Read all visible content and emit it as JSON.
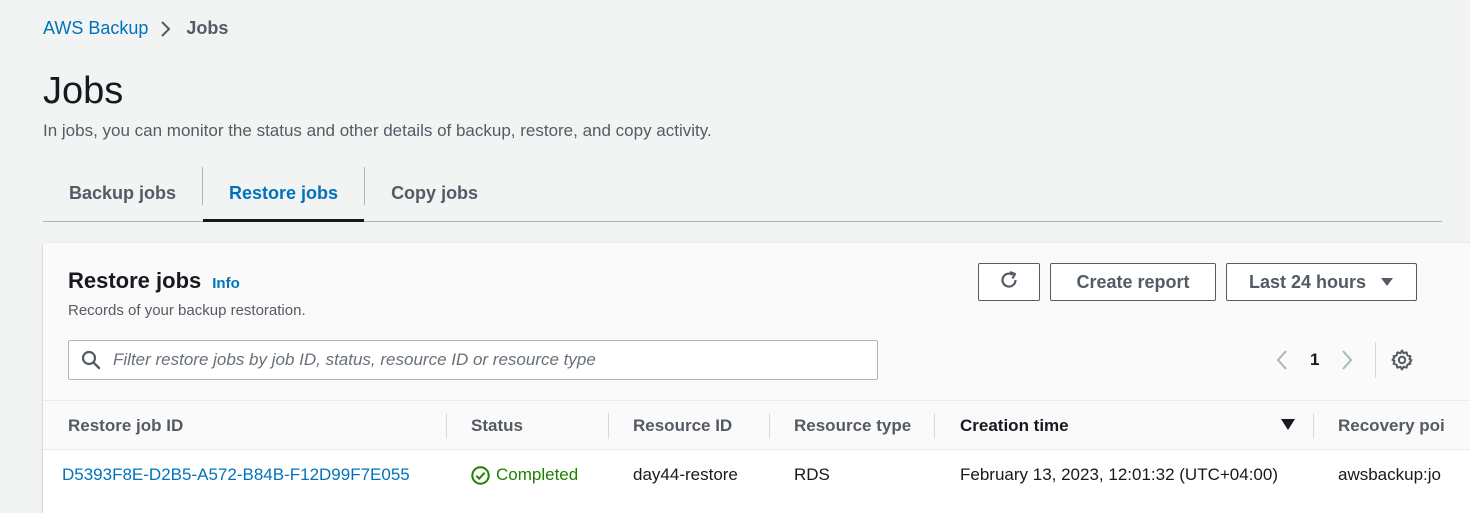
{
  "breadcrumb": {
    "root": "AWS Backup",
    "current": "Jobs"
  },
  "page": {
    "title": "Jobs",
    "description": "In jobs, you can monitor the status and other details of backup, restore, and copy activity."
  },
  "tabs": [
    {
      "label": "Backup jobs",
      "active": false
    },
    {
      "label": "Restore jobs",
      "active": true
    },
    {
      "label": "Copy jobs",
      "active": false
    }
  ],
  "panel": {
    "title": "Restore jobs",
    "info": "Info",
    "description": "Records of your backup restoration.",
    "refresh_icon": "refresh-icon",
    "create_report": "Create report",
    "time_range": "Last 24 hours",
    "search_placeholder": "Filter restore jobs by job ID, status, resource ID or resource type",
    "page_number": "1"
  },
  "table": {
    "columns": [
      "Restore job ID",
      "Status",
      "Resource ID",
      "Resource type",
      "Creation time",
      "Recovery poi"
    ],
    "sorted_column": "Creation time",
    "rows": [
      {
        "job_id": "D5393F8E-D2B5-A572-B84B-F12D99F7E055",
        "status": "Completed",
        "resource_id": "day44-restore",
        "resource_type": "RDS",
        "creation_time": "February 13, 2023, 12:01:32 (UTC+04:00)",
        "recovery_point": "awsbackup:jo"
      }
    ]
  },
  "colors": {
    "link": "#0073bb",
    "success": "#1d8102",
    "text": "#16191f",
    "muted": "#545b64",
    "background": "#f2f3f3"
  }
}
